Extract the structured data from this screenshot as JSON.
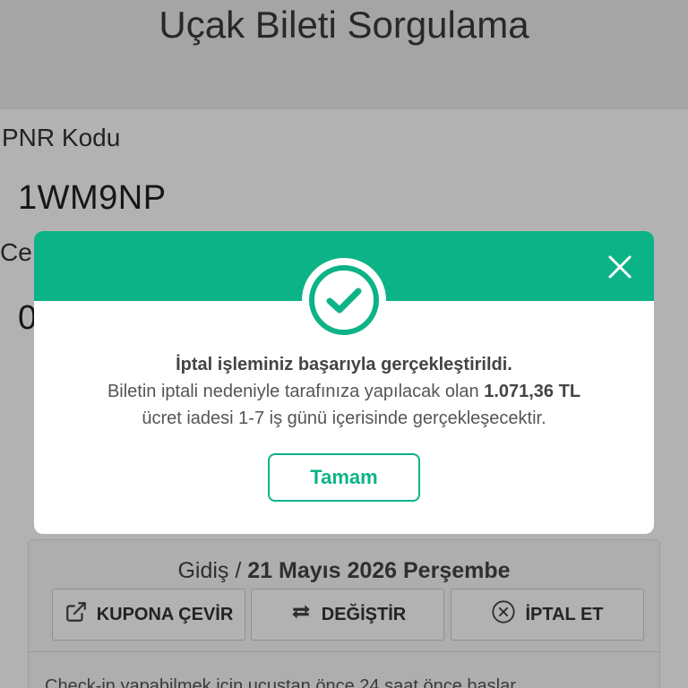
{
  "page": {
    "title": "Uçak Bileti Sorgulama",
    "pnr_label": "PNR Kodu",
    "pnr_value": "1WM9NP",
    "surname_label_partial": "Ce",
    "surname_value_partial": "0"
  },
  "flight": {
    "direction": "Gidiş",
    "separator": " / ",
    "date": "21 Mayıs 2026 Perşembe",
    "actions": {
      "coupon_label": "KUPONA ÇEVİR",
      "change_label": "DEĞİŞTİR",
      "cancel_label": "İPTAL ET"
    },
    "footer_text": "Check-in yapabilmek için uçuştan önce 24 saat önce başlar..."
  },
  "modal": {
    "headline": "İptal işleminiz başarıyla gerçekleştirildi.",
    "body_prefix": "Biletin iptali nedeniyle tarafınıza yapılacak olan ",
    "refund_amount": "1.071,36 TL",
    "body_suffix": "ücret iadesi 1-7 iş günü içerisinde gerçekleşecektir.",
    "ok_label": "Tamam"
  },
  "icons": {
    "close": "close-icon",
    "success": "check-circle-icon",
    "coupon": "external-link-icon",
    "change": "swap-arrows-icon",
    "cancel": "x-circle-icon"
  },
  "colors": {
    "accent": "#0cb387",
    "overlay": "rgba(0,0,0,0.30)"
  }
}
